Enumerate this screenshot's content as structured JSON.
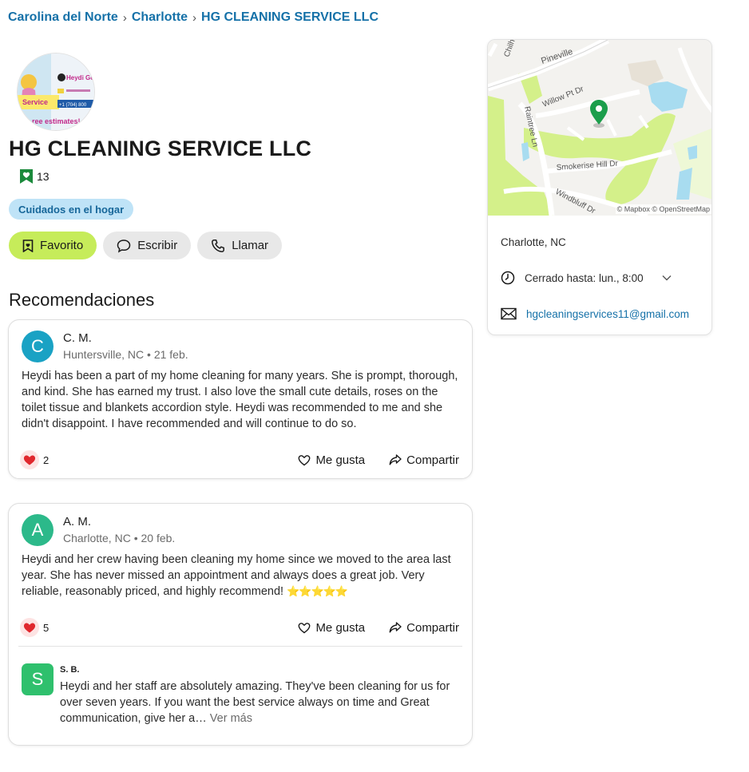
{
  "breadcrumb": [
    "Carolina del Norte",
    "Charlotte",
    "HG CLEANING SERVICE LLC"
  ],
  "business": {
    "name": "HG CLEANING SERVICE LLC",
    "favorites_count": "13",
    "category": "Cuidados en el hogar",
    "logo_text": {
      "line1": "Heydi Go",
      "line2": "Service",
      "line3": "ree estimates!",
      "phone": "+1 (704) 800"
    }
  },
  "actions": {
    "favorite": "Favorito",
    "write": "Escribir",
    "call": "Llamar"
  },
  "recommendations_title": "Recomendaciones",
  "reviews": [
    {
      "initial": "C",
      "name": "C. M.",
      "meta": "Huntersville, NC • 21 feb.",
      "text": "Heydi has been a part of my home cleaning for many years. She is prompt, thorough, and kind. She has earned my trust. I also love the small cute details, roses on the toilet tissue and blankets accordion style. Heydi was recommended to me and she didn't disappoint. I have recommended and will continue to do so.",
      "reactions": "2",
      "avatar_color": "#1aa2c4"
    },
    {
      "initial": "A",
      "name": "A. M.",
      "meta": "Charlotte, NC • 20 feb.",
      "text": "Heydi and her crew having been cleaning my home since we moved to the area last year. She has never missed an appointment and always does a great job. Very reliable, reasonably priced, and highly recommend!",
      "stars": "⭐⭐⭐⭐⭐",
      "reactions": "5",
      "avatar_color": "#2cb98a"
    }
  ],
  "reply": {
    "initial": "S",
    "name": "S. B.",
    "text": "Heydi and her staff are absolutely amazing. They've been cleaning for us for over seven years. If you want the best service always on time and Great communication, give her a…",
    "see_more": "Ver más"
  },
  "footer_labels": {
    "like": "Me gusta",
    "share": "Compartir"
  },
  "sidebar": {
    "map_streets": [
      "Pineville",
      "Chilh",
      "Willow Pt Dr",
      "Raintree Ln",
      "Smokerise Hill Dr",
      "Windbluff Dr"
    ],
    "attribution": "© Mapbox © OpenStreetMap",
    "city": "Charlotte, NC",
    "hours": "Cerrado hasta: lun., 8:00",
    "email": "hgcleaningservices11@gmail.com"
  },
  "colors": {
    "link": "#1571a8",
    "primary_button": "#c6ec5a",
    "chip_bg": "#bfe3f7",
    "pin": "#1b9e4b",
    "park": "#d4f08a"
  }
}
